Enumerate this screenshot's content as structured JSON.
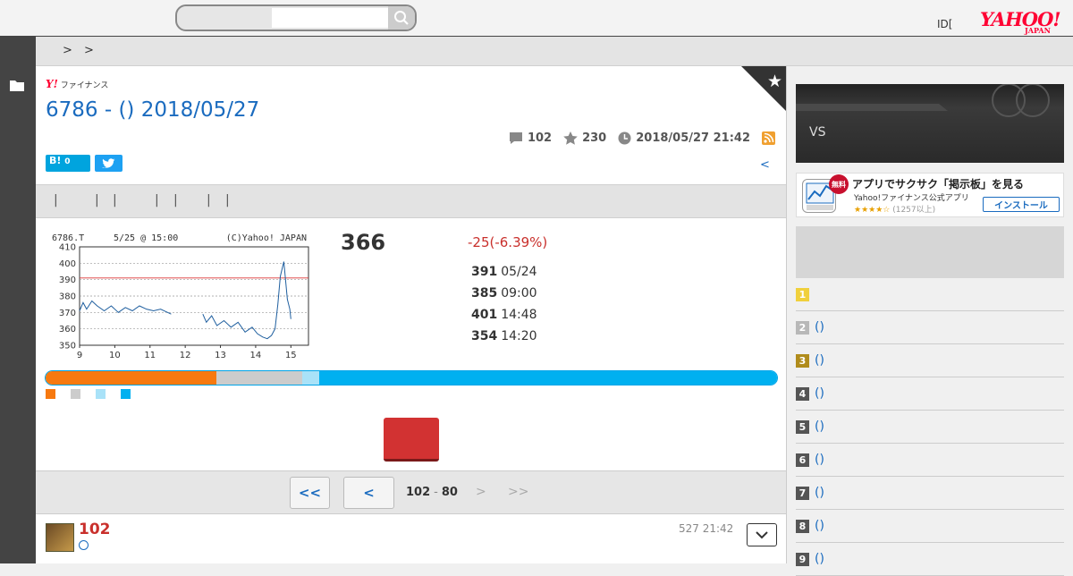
{
  "header": {
    "search_placeholder": "",
    "id_link": "ID[",
    "logo": "YAHOO!",
    "logo_sub": "JAPAN"
  },
  "breadcrumb": [
    ">",
    ">"
  ],
  "page": {
    "finance_logo_y": "Y!",
    "finance_logo_text": "ファイナンス",
    "title": "6786 - () 2018/05/27",
    "stats": {
      "comments": "102",
      "favorites": "230",
      "datetime": "2018/05/27 21:42"
    },
    "hatena_label": "B!",
    "hatena_count": "0",
    "back_link": "<",
    "tabs": [
      "|",
      "|",
      "|",
      "|",
      "|",
      "|",
      "|",
      "|"
    ]
  },
  "stock": {
    "price": "366",
    "change": "-25(-6.39%)",
    "quotes": [
      {
        "value": "391",
        "time": "05/24"
      },
      {
        "value": "385",
        "time": "09:00"
      },
      {
        "value": "401",
        "time": "14:48"
      },
      {
        "value": "354",
        "time": "14:20"
      }
    ],
    "sentiment": [
      {
        "color": "#f7790f",
        "fraction": 0.234
      },
      {
        "color": "#cccccc",
        "fraction": 0.117
      },
      {
        "color": "#a9e2f8",
        "fraction": 0.023
      },
      {
        "color": "#00b0f0",
        "fraction": 0.626
      }
    ]
  },
  "chart_data": {
    "type": "line",
    "header_left": "6786.T",
    "header_mid": "5/25 @ 15:00",
    "header_right": "(C)Yahoo! JAPAN",
    "x_ticks": [
      "9",
      "10",
      "11",
      "12",
      "13",
      "14",
      "15"
    ],
    "y_ticks": [
      "410",
      "400",
      "390",
      "380",
      "370",
      "360",
      "350"
    ],
    "ylim": [
      350,
      410
    ],
    "xlim": [
      9,
      15.5
    ],
    "reference_line": 391,
    "grid": true,
    "series": [
      {
        "points": [
          [
            9.0,
            371
          ],
          [
            9.1,
            376
          ],
          [
            9.2,
            372
          ],
          [
            9.35,
            377
          ],
          [
            9.5,
            374
          ],
          [
            9.7,
            371
          ],
          [
            9.9,
            374
          ],
          [
            10.1,
            370
          ],
          [
            10.3,
            373
          ],
          [
            10.5,
            371
          ],
          [
            10.7,
            374
          ],
          [
            10.9,
            372
          ],
          [
            11.1,
            371
          ],
          [
            11.3,
            372
          ],
          [
            11.5,
            370
          ],
          [
            11.6,
            369
          ]
        ],
        "color": "#1f5f9f"
      },
      {
        "points": [
          [
            12.5,
            369
          ],
          [
            12.6,
            364
          ],
          [
            12.75,
            368
          ],
          [
            12.9,
            362
          ],
          [
            13.1,
            365
          ],
          [
            13.3,
            361
          ],
          [
            13.5,
            364
          ],
          [
            13.7,
            358
          ],
          [
            13.9,
            361
          ],
          [
            14.05,
            357
          ],
          [
            14.2,
            355
          ],
          [
            14.33,
            354
          ],
          [
            14.45,
            356
          ],
          [
            14.55,
            360
          ],
          [
            14.63,
            375
          ],
          [
            14.7,
            392
          ],
          [
            14.8,
            401
          ],
          [
            14.9,
            378
          ],
          [
            14.97,
            372
          ],
          [
            15.0,
            366
          ]
        ],
        "color": "#1f5f9f"
      }
    ]
  },
  "vote_button": "",
  "pager": {
    "first": "<<",
    "prev": "<",
    "from": "102",
    "dash": "-",
    "to": "80",
    "next": ">",
    "last": ">>"
  },
  "post": {
    "number": "102",
    "date": "527 21:42"
  },
  "sidebar": {
    "banner_text": "VS",
    "app_ad": {
      "badge": "無料",
      "title": "アプリでサクサク「掲示板」を見る",
      "subtitle": "Yahoo!ファイナンス公式アプリ",
      "stars": "★★★★☆",
      "count": "(1257以上)",
      "install": "インストール"
    },
    "ranking": [
      {
        "n": "1",
        "label": "",
        "color": "#f0d03c"
      },
      {
        "n": "2",
        "label": "()",
        "color": "#b8b8b8"
      },
      {
        "n": "3",
        "label": "()",
        "color": "#b08c1c"
      },
      {
        "n": "4",
        "label": "()",
        "color": "#555555"
      },
      {
        "n": "5",
        "label": "()",
        "color": "#555555"
      },
      {
        "n": "6",
        "label": "()",
        "color": "#555555"
      },
      {
        "n": "7",
        "label": "()",
        "color": "#555555"
      },
      {
        "n": "8",
        "label": "()",
        "color": "#555555"
      },
      {
        "n": "9",
        "label": "()",
        "color": "#555555"
      }
    ]
  }
}
